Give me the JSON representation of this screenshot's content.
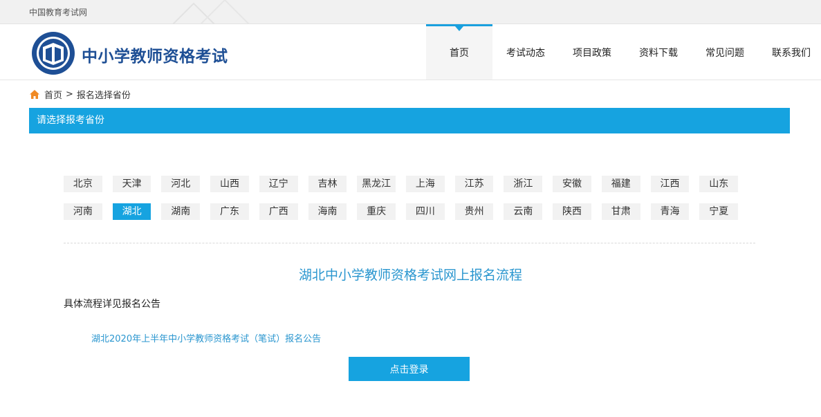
{
  "topbar": {
    "site_name": "中国教育考试网"
  },
  "header": {
    "brand": "中小学教师资格考试",
    "nav": [
      {
        "label": "首页",
        "active": true
      },
      {
        "label": "考试动态",
        "active": false
      },
      {
        "label": "项目政策",
        "active": false
      },
      {
        "label": "资料下载",
        "active": false
      },
      {
        "label": "常见问题",
        "active": false
      },
      {
        "label": "联系我们",
        "active": false
      }
    ]
  },
  "breadcrumb": {
    "home": "首页",
    "separator": ">",
    "current": "报名选择省份"
  },
  "section": {
    "title": "请选择报考省份"
  },
  "provinces": {
    "selected": "湖北",
    "row1": [
      "北京",
      "天津",
      "河北",
      "山西",
      "辽宁",
      "吉林",
      "黑龙江",
      "上海",
      "江苏",
      "浙江",
      "安徽",
      "福建",
      "江西",
      "山东"
    ],
    "row2": [
      "河南",
      "湖北",
      "湖南",
      "广东",
      "广西",
      "海南",
      "重庆",
      "四川",
      "贵州",
      "云南",
      "陕西",
      "甘肃",
      "青海",
      "宁夏"
    ]
  },
  "flow": {
    "title": "湖北中小学教师资格考试网上报名流程",
    "description": "具体流程详见报名公告",
    "notice_link": "湖北2020年上半年中小学教师资格考试（笔试）报名公告",
    "login_button": "点击登录"
  },
  "colors": {
    "accent": "#16a3e0",
    "brand": "#1e4f95",
    "link": "#2a96cf"
  }
}
